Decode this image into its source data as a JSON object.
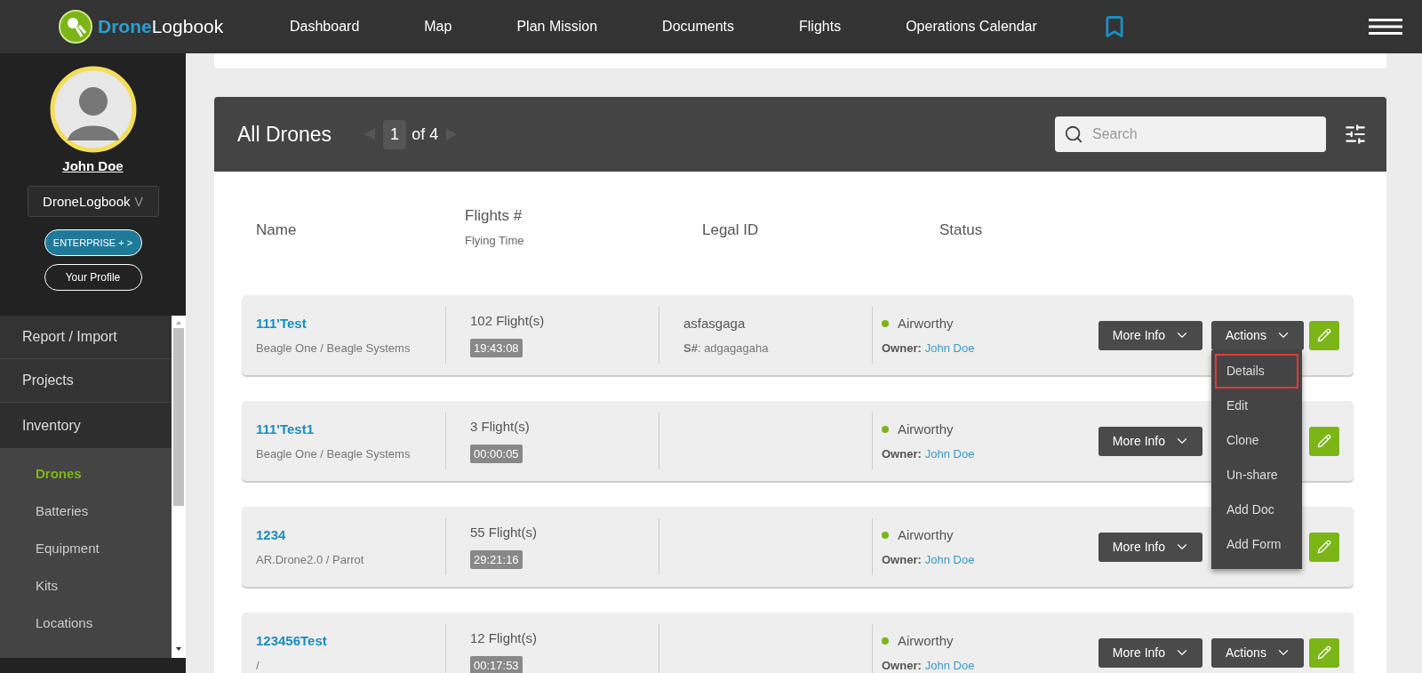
{
  "nav": {
    "logo": {
      "first": "Drone",
      "second": "Logbook"
    },
    "links": [
      {
        "label": "Dashboard"
      },
      {
        "label": "Map"
      },
      {
        "label": "Plan Mission"
      },
      {
        "label": "Documents"
      },
      {
        "label": "Flights"
      },
      {
        "label": "Operations Calendar"
      }
    ]
  },
  "user": {
    "name": "John Doe",
    "organization": "DroneLogbook",
    "org_caret": "V",
    "enterprise_button": "ENTERPRISE + >",
    "profile_button": "Your Profile"
  },
  "sidebar": {
    "items": [
      {
        "label": "Report / Import",
        "expanded": false
      },
      {
        "label": "Projects",
        "expanded": false
      },
      {
        "label": "Inventory",
        "expanded": true,
        "children": [
          {
            "label": "Drones",
            "selected": true
          },
          {
            "label": "Batteries",
            "selected": false
          },
          {
            "label": "Equipment",
            "selected": false
          },
          {
            "label": "Kits",
            "selected": false
          },
          {
            "label": "Locations",
            "selected": false
          }
        ]
      }
    ]
  },
  "panel": {
    "title": "All Drones",
    "pagination": {
      "page": "1",
      "total": "of 4"
    },
    "search": {
      "placeholder": "Search"
    }
  },
  "table": {
    "columns": [
      {
        "label": "Name"
      },
      {
        "label": "Flights #",
        "sublabel": "Flying Time"
      },
      {
        "label": "Legal ID"
      },
      {
        "label": "Status"
      }
    ],
    "rows": [
      {
        "name": "111'Test",
        "model": "Beagle One / Beagle Systems",
        "flights": "102 Flight(s)",
        "time": "19:43:08",
        "legal_id": "asfasgaga",
        "serial": "**S#**: adgagagaha",
        "status": "Airworthy",
        "owner_label": "Owner:",
        "owner": "John Doe",
        "more_info": "More Info",
        "actions": "Actions",
        "menu": [
          {
            "label": "Details",
            "selected": true
          },
          {
            "label": "Edit",
            "selected": false
          },
          {
            "label": "Clone",
            "selected": false
          },
          {
            "label": "Un-share",
            "selected": false
          },
          {
            "label": "Add Doc",
            "selected": false
          },
          {
            "label": "Add Form",
            "selected": false
          }
        ]
      },
      {
        "name": "111'Test1",
        "model": "Beagle One / Beagle Systems",
        "flights": "3 Flight(s)",
        "time": "00:00:05",
        "status": "Airworthy",
        "owner_label": "Owner:",
        "owner": "John Doe",
        "more_info": "More Info"
      },
      {
        "name": "1234",
        "model": "AR.Drone2.0 / Parrot",
        "flights": "55 Flight(s)",
        "time": "29:21:16",
        "status": "Airworthy",
        "owner_label": "Owner:",
        "owner": "John Doe",
        "more_info": "More Info"
      },
      {
        "name": "123456Test",
        "model": "/",
        "flights": "12 Flight(s)",
        "time": "00:17:53",
        "status": "Airworthy",
        "owner_label": "Owner:",
        "owner": "John Doe",
        "more_info": "More Info",
        "actions": "Actions"
      }
    ]
  }
}
